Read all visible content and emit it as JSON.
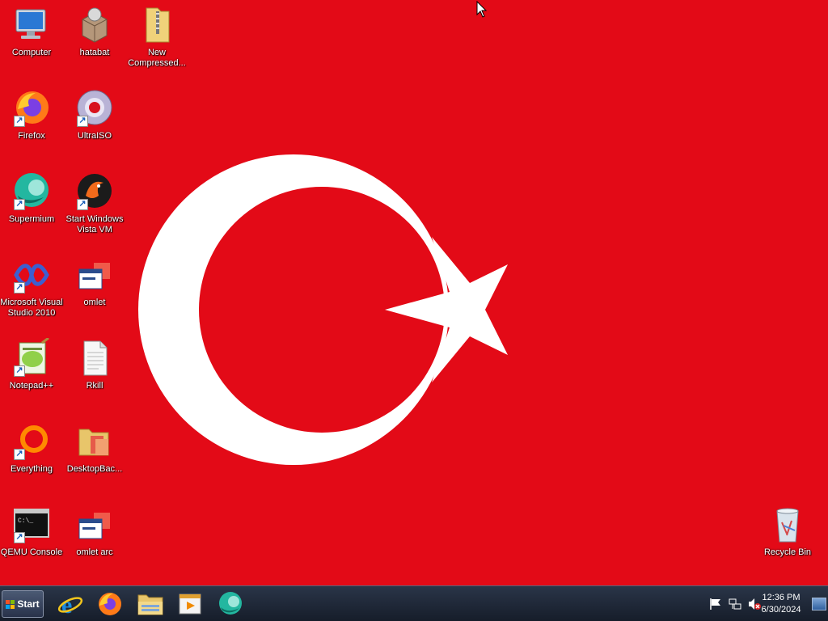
{
  "desktop": {
    "icons": [
      {
        "label": "Computer",
        "icon": "computer-icon"
      },
      {
        "label": "hatabat",
        "icon": "package-icon"
      },
      {
        "label": "New Compressed...",
        "icon": "zip-folder-icon"
      },
      {
        "label": "Firefox",
        "icon": "firefox-icon"
      },
      {
        "label": "UltraISO",
        "icon": "disc-icon"
      },
      {
        "label": "Supermium",
        "icon": "supermium-icon"
      },
      {
        "label": "Start Windows Vista VM",
        "icon": "vm-icon"
      },
      {
        "label": "Microsoft Visual Studio 2010",
        "icon": "visual-studio-icon"
      },
      {
        "label": "omlet",
        "icon": "window-app-icon"
      },
      {
        "label": "Notepad++",
        "icon": "notepad-plus-icon"
      },
      {
        "label": "Rkill",
        "icon": "document-icon"
      },
      {
        "label": "Everything",
        "icon": "everything-icon"
      },
      {
        "label": "DesktopBac...",
        "icon": "folder-icon"
      },
      {
        "label": "QEMU Console",
        "icon": "console-icon"
      },
      {
        "label": "omlet arc",
        "icon": "window-app-icon"
      },
      {
        "label": "Recycle Bin",
        "icon": "recycle-bin-icon"
      }
    ]
  },
  "taskbar": {
    "start_label": "Start",
    "pinned": [
      "internet-explorer-icon",
      "firefox-icon",
      "file-explorer-icon",
      "media-player-icon",
      "supermium-icon"
    ]
  },
  "tray": {
    "icons": [
      "action-center-flag-icon",
      "network-icon",
      "volume-muted-icon"
    ],
    "time": "12:36 PM",
    "date": "6/30/2024"
  },
  "colors": {
    "wallpaper_red": "#e30a17",
    "wallpaper_white": "#ffffff",
    "taskbar": "#1e2636"
  }
}
